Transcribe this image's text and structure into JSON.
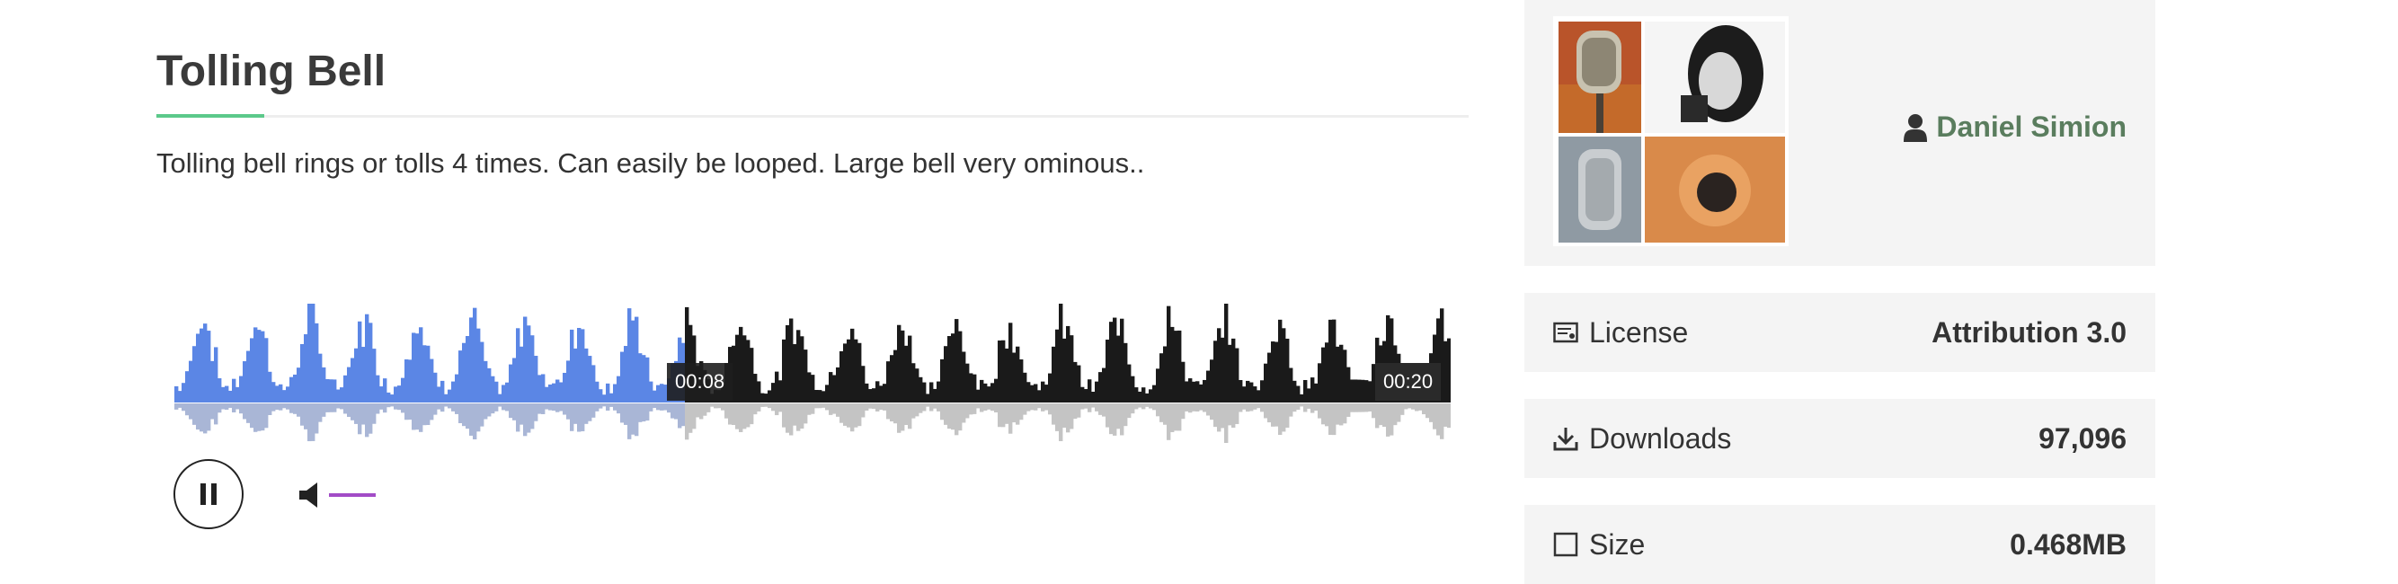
{
  "sound": {
    "title": "Tolling Bell",
    "description": "Tolling bell rings or tolls 4 times. Can easily be looped. Large bell very ominous.."
  },
  "player": {
    "elapsed": "00:08",
    "duration": "00:20",
    "progress": 0.4,
    "volume": 0.9,
    "state": "playing",
    "colors": {
      "played_top": "#5b86e5",
      "played_bottom": "#a9b6d6",
      "unplayed_top": "#1a1a1a",
      "unplayed_bottom": "#c4c4c4",
      "volume": "#a24cc7"
    }
  },
  "author": {
    "name": "Daniel Simion",
    "icon": "user-icon"
  },
  "details": {
    "license_label": "License",
    "license_value": "Attribution 3.0",
    "downloads_label": "Downloads",
    "downloads_value": "97,096",
    "size_label": "Size",
    "size_value": "0.468MB"
  },
  "colors": {
    "accent": "#5cc98a",
    "author_link": "#5a7d5e",
    "card_bg": "#f4f4f4"
  }
}
